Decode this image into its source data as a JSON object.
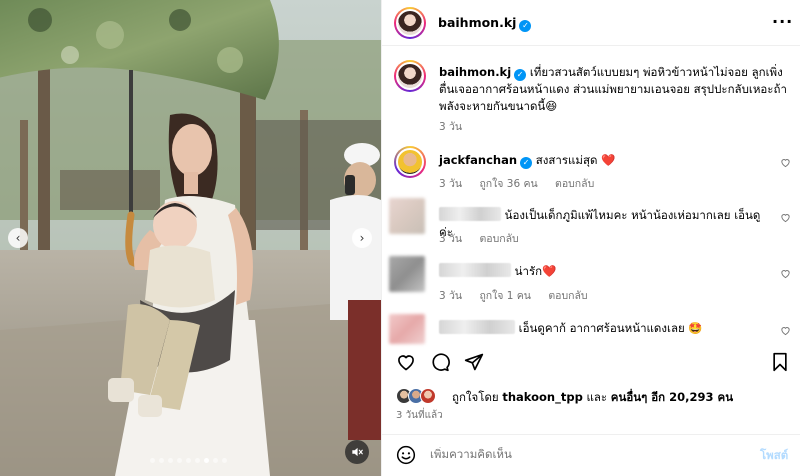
{
  "post": {
    "username": "baihmon.kj",
    "caption": "เที่ยวสวนสัตว์แบบยมๆ พ่อหิวข้าวหน้าไม่จอย ลูกเพิ่งตื่นเจออากาศร้อนหน้าแดง ส่วนแม่พยายามเอนจอย สรุปปะกลับเหอะถ้าพลังจะหายกันขนาดนี้😆",
    "caption_time": "3 วัน"
  },
  "comments": [
    {
      "username": "jackfanchan",
      "text": "สงสารแม่สุด",
      "heart": "❤️",
      "time": "3 วัน",
      "likes": "ถูกใจ 36 คน",
      "reply": "ตอบกลับ"
    },
    {
      "text": "น้องเป็นเด็กภูมิแพ้ไหมคะ หน้าน้องเห่อมากเลย เอ็นดูค่ะ",
      "time": "3 วัน",
      "reply": "ตอบกลับ"
    },
    {
      "text": "น่ารัก",
      "heart": "❤️",
      "time": "3 วัน",
      "likes": "ถูกใจ 1 คน",
      "reply": "ตอบกลับ"
    },
    {
      "text": "เอ็นดูคาก้ อากาศร้อนหน้าแดงเลย",
      "emoji": "🤩"
    }
  ],
  "likes_summary": {
    "prefix": "ถูกใจโดย",
    "user": "thakoon_tpp",
    "middle": "และ",
    "others": "คนอื่นๆ อีก 20,293 คน"
  },
  "posted_ago": "3 วันที่แล้ว",
  "add_comment": {
    "placeholder": "เพิ่มความคิดเห็น",
    "post_label": "โพสต์"
  },
  "icons": {
    "verified": "verified-badge-icon",
    "more": "more-options-icon",
    "like": "heart-icon",
    "comment": "comment-icon",
    "share": "share-icon",
    "save": "bookmark-icon",
    "emoji": "emoji-icon",
    "mute": "mute-icon"
  },
  "colors": {
    "verified": "#0095f6",
    "heart": "#ed4956",
    "secondary_text": "#737373",
    "post_button_disabled": "#b3dbff"
  },
  "carousel": {
    "total": 9,
    "active": 6
  }
}
